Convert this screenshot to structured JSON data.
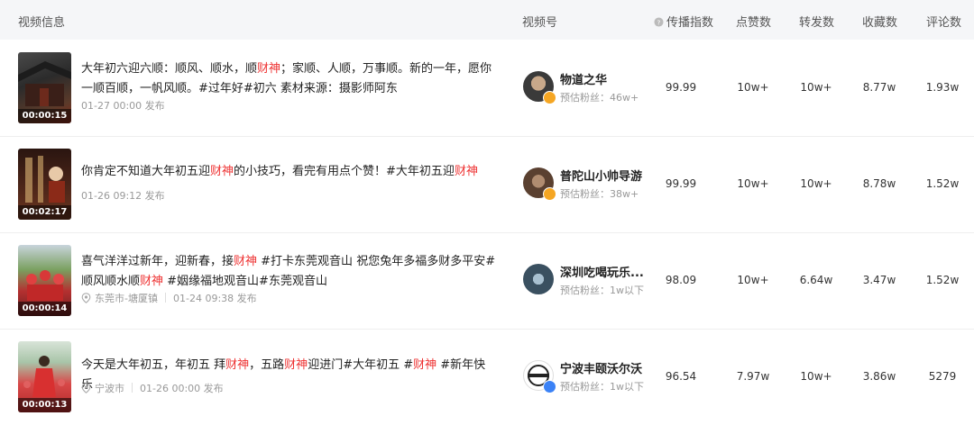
{
  "header": {
    "video_info": "视频信息",
    "account": "视频号",
    "spread_index": "传播指数",
    "likes": "点赞数",
    "shares": "转发数",
    "favorites": "收藏数",
    "comments": "评论数",
    "info_icon": "question-circle-icon"
  },
  "rows": [
    {
      "duration": "00:00:15",
      "title_parts": [
        "大年初六迎六顺：顺风、顺水，顺",
        "财神",
        "；家顺、人顺，万事顺。新的一年，愿你一顺百顺，一帆风顺。#过年好#初六 素材来源：摄影师阿东"
      ],
      "location": "",
      "time": "01-27 00:00 发布",
      "author": "物道之华",
      "fans": "预估粉丝：46w+",
      "badge_color": "#f5a623",
      "spread": "99.99",
      "likes": "10w+",
      "shares": "10w+",
      "favorites": "8.77w",
      "comments": "1.93w"
    },
    {
      "duration": "00:02:17",
      "title_parts": [
        "你肯定不知道大年初五迎",
        "财神",
        "的小技巧，看完有用点个赞！#大年初五迎",
        "财神",
        ""
      ],
      "location": "",
      "time": "01-26 09:12 发布",
      "author": "普陀山小帅导游",
      "fans": "预估粉丝：38w+",
      "badge_color": "#f5a623",
      "spread": "99.99",
      "likes": "10w+",
      "shares": "10w+",
      "favorites": "8.78w",
      "comments": "1.52w"
    },
    {
      "duration": "00:00:14",
      "title_parts": [
        "喜气洋洋过新年，迎新春，接",
        "财神",
        " #打卡东莞观音山 祝您兔年多福多财多平安#顺风顺水顺",
        "财神",
        " #姻缘福地观音山#东莞观音山"
      ],
      "location": "东莞市-塘厦镇",
      "time": "01-24 09:38 发布",
      "author": "深圳吃喝玩乐...",
      "fans": "预估粉丝：1w以下",
      "badge_color": "",
      "spread": "98.09",
      "likes": "10w+",
      "shares": "6.64w",
      "favorites": "3.47w",
      "comments": "1.52w"
    },
    {
      "duration": "00:00:13",
      "title_parts": [
        "今天是大年初五，年初五 拜",
        "财神",
        "，五路",
        "财神",
        "迎进门#大年初五 #",
        "财神",
        " #新年快乐"
      ],
      "location": "宁波市",
      "time": "01-26 00:00 发布",
      "author": "宁波丰颐沃尔沃",
      "fans": "预估粉丝：1w以下",
      "badge_color": "#3b82f6",
      "spread": "96.54",
      "likes": "7.97w",
      "shares": "10w+",
      "favorites": "3.86w",
      "comments": "5279"
    }
  ],
  "colors": {
    "highlight": "#e33333",
    "header_bg": "#f5f6f8"
  },
  "icons": {
    "location": "location-pin-icon",
    "verified": "verified-badge-icon"
  }
}
